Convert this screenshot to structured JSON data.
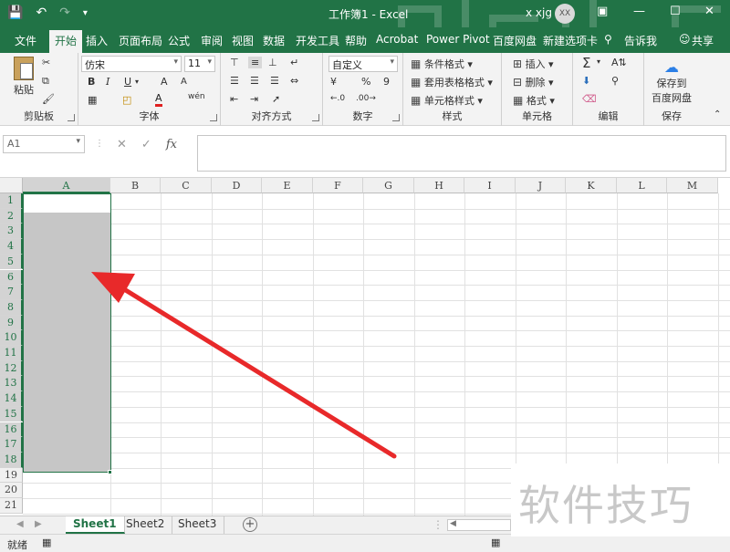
{
  "window": {
    "title": "工作簿1  -  Excel",
    "user_name": "x xjg",
    "avatar_initials": "XX",
    "accent": "#217346"
  },
  "tabs": [
    "文件",
    "开始",
    "插入",
    "页面布局",
    "公式",
    "审阅",
    "视图",
    "数据",
    "开发工具",
    "帮助",
    "Acrobat",
    "Power Pivot",
    "百度网盘",
    "新建选项卡",
    "告诉我",
    "共享"
  ],
  "ribbon": {
    "clipboard": {
      "paste": "粘贴",
      "label": "剪贴板"
    },
    "font": {
      "name": "仿宋",
      "size": "11",
      "label": "字体",
      "bold": "B",
      "italic": "I",
      "underline": "U",
      "grow": "A",
      "shrink": "A",
      "color": "A",
      "phonetic": "wén"
    },
    "alignment": {
      "label": "对齐方式"
    },
    "number": {
      "format": "自定义",
      "percent": "%",
      "comma": "9",
      "label": "数字"
    },
    "styles": {
      "conditional": "条件格式",
      "table": "套用表格格式",
      "cell": "单元格样式",
      "label": "样式"
    },
    "cells": {
      "insert": "插入",
      "delete": "删除",
      "format": "格式",
      "label": "单元格"
    },
    "editing": {
      "label": "编辑"
    },
    "save": {
      "line1": "保存到",
      "line2": "百度网盘",
      "label": "保存"
    }
  },
  "formula_bar": {
    "name_box": "A1",
    "fx": "fx",
    "value": ""
  },
  "columns": [
    "A",
    "B",
    "C",
    "D",
    "E",
    "F",
    "G",
    "H",
    "I",
    "J",
    "K",
    "L",
    "M"
  ],
  "rows": [
    "1",
    "2",
    "3",
    "4",
    "5",
    "6",
    "7",
    "8",
    "9",
    "10",
    "11",
    "12",
    "13",
    "14",
    "15",
    "16",
    "17",
    "18",
    "19",
    "20",
    "21"
  ],
  "selection": {
    "range": "A1:A18",
    "color": "#217346"
  },
  "sheets": [
    "Sheet1",
    "Sheet2",
    "Sheet3"
  ],
  "active_sheet": "Sheet1",
  "status": {
    "ready": "就绪"
  },
  "watermark": "软件技巧"
}
